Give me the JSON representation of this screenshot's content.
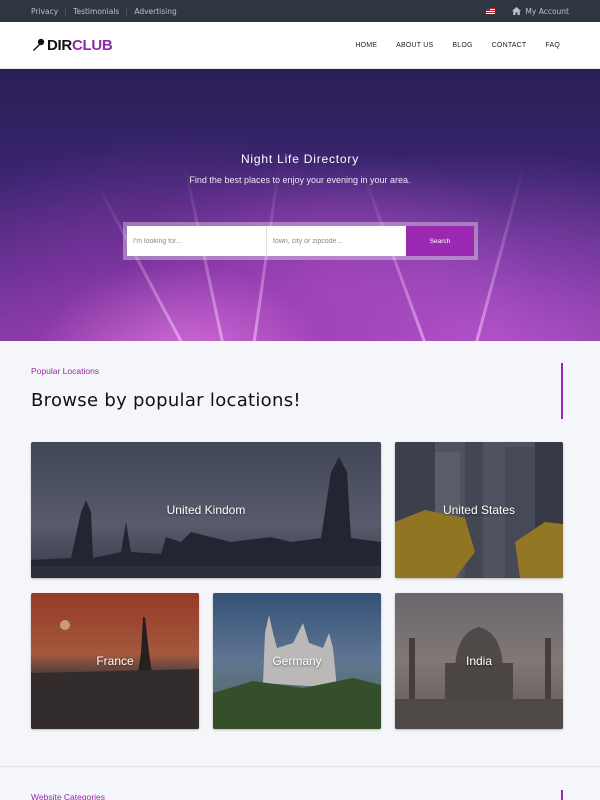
{
  "topbar": {
    "links": [
      "Privacy",
      "Testimonials",
      "Advertising"
    ],
    "account_label": "My Account"
  },
  "header": {
    "logo_part1": "DIR",
    "logo_part2": "CLUB",
    "nav": [
      "HOME",
      "ABOUT US",
      "BLOG",
      "CONTACT",
      "FAQ"
    ]
  },
  "hero": {
    "title": "Night Life Directory",
    "subtitle": "Find the best places to enjoy your evening in your area.",
    "search": {
      "what_placeholder": "I'm looking for...",
      "where_placeholder": "town, city or zipcode...",
      "button_label": "Search"
    }
  },
  "locations": {
    "label": "Popular Locations",
    "title": "Browse by popular locations!",
    "cards": [
      "United Kindom",
      "United States",
      "France",
      "Germany",
      "India"
    ]
  },
  "categories": {
    "label": "Website Categories"
  },
  "colors": {
    "accent": "#9b28b0",
    "topbar": "#2f3640"
  }
}
